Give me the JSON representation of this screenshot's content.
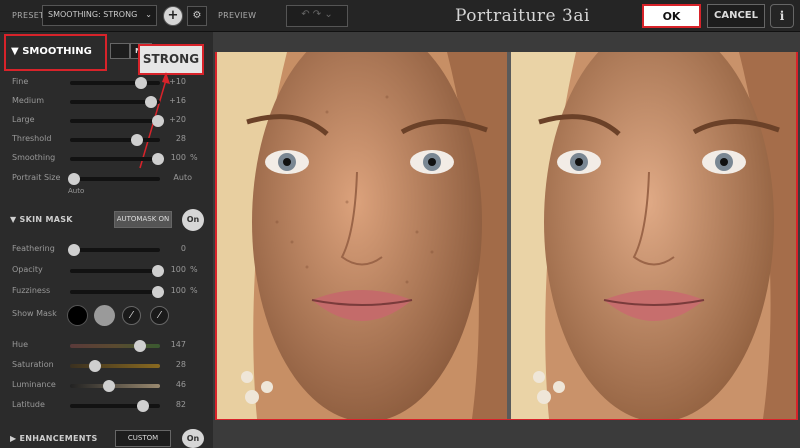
{
  "toolbar": {
    "preset_label": "PRESET",
    "preset_value": "SMOOTHING: STRONG",
    "add_icon": "plus-icon",
    "gear_icon": "gear-icon",
    "preview_label": "PREVIEW",
    "app_title": "Portraiture 3ai",
    "ok_label": "OK",
    "cancel_label": "CANCEL",
    "info_icon": "info-icon"
  },
  "smoothing": {
    "title": "SMOOTHING",
    "callout": "STRONG",
    "preset_buttons": [
      "",
      "ME"
    ],
    "rows": [
      {
        "name": "Fine",
        "value": "+10",
        "unit": "",
        "level": 0.8
      },
      {
        "name": "Medium",
        "value": "+16",
        "unit": "",
        "level": 0.92
      },
      {
        "name": "Large",
        "value": "+20",
        "unit": "",
        "level": 1.0
      },
      {
        "name": "Threshold",
        "value": "28",
        "unit": "",
        "level": 0.75
      },
      {
        "name": "Smoothing",
        "value": "100",
        "unit": "%",
        "level": 1.0
      }
    ],
    "portrait_size": {
      "name": "Portrait Size",
      "value": "Auto",
      "sub": "Auto",
      "level": 0.0
    }
  },
  "skin_mask": {
    "title": "SKIN MASK",
    "automask_label": "AUTOMASK ON",
    "toggle_label": "On",
    "rows": [
      {
        "name": "Feathering",
        "value": "0",
        "unit": "",
        "level": 0.0
      },
      {
        "name": "Opacity",
        "value": "100",
        "unit": "%",
        "level": 1.0
      },
      {
        "name": "Fuzziness",
        "value": "100",
        "unit": "%",
        "level": 1.0
      }
    ],
    "show_mask_label": "Show Mask",
    "color_rows": [
      {
        "name": "Hue",
        "value": "147",
        "level": 0.78
      },
      {
        "name": "Saturation",
        "value": "28",
        "level": 0.25
      },
      {
        "name": "Luminance",
        "value": "46",
        "level": 0.42
      },
      {
        "name": "Latitude",
        "value": "82",
        "level": 0.82
      }
    ]
  },
  "enhancements": {
    "title": "ENHANCEMENTS",
    "preset": "CUSTOM",
    "toggle_label": "On"
  },
  "colors": {
    "accent_red": "#d8232a",
    "panel": "#333333",
    "background": "#2b2b2b"
  }
}
